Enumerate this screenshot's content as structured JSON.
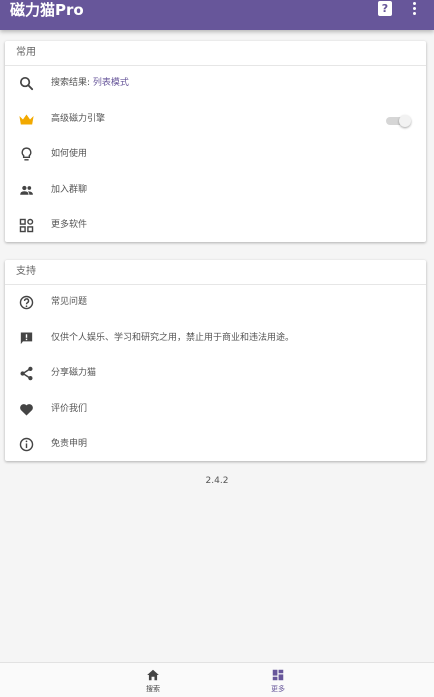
{
  "appbar": {
    "title": "磁力猫Pro",
    "help_icon": "?"
  },
  "section_common": {
    "header": "常用",
    "items": [
      {
        "icon": "search-icon",
        "label": "搜索结果: ",
        "value": "列表模式"
      },
      {
        "icon": "crown-icon",
        "label": "高级磁力引擎",
        "toggle_on": false
      },
      {
        "icon": "lightbulb-icon",
        "label": "如何使用"
      },
      {
        "icon": "group-icon",
        "label": "加入群聊"
      },
      {
        "icon": "apps-icon",
        "label": "更多软件"
      }
    ]
  },
  "section_support": {
    "header": "支持",
    "items": [
      {
        "icon": "help-circle-icon",
        "label": "常见问题"
      },
      {
        "icon": "feedback-icon",
        "label": "仅供个人娱乐、学习和研究之用，禁止用于商业和违法用途。"
      },
      {
        "icon": "share-icon",
        "label": "分享磁力猫"
      },
      {
        "icon": "heart-icon",
        "label": "评价我们"
      },
      {
        "icon": "info-icon",
        "label": "免责申明"
      }
    ]
  },
  "version": "2.4.2",
  "bottom_nav": {
    "items": [
      {
        "icon": "home-icon",
        "label": "搜索",
        "active": false
      },
      {
        "icon": "dashboard-icon",
        "label": "更多",
        "active": true
      }
    ]
  },
  "colors": {
    "primary": "#67569a",
    "crown": "#f2a900",
    "icon": "#444444",
    "background": "#f5f5f5"
  }
}
